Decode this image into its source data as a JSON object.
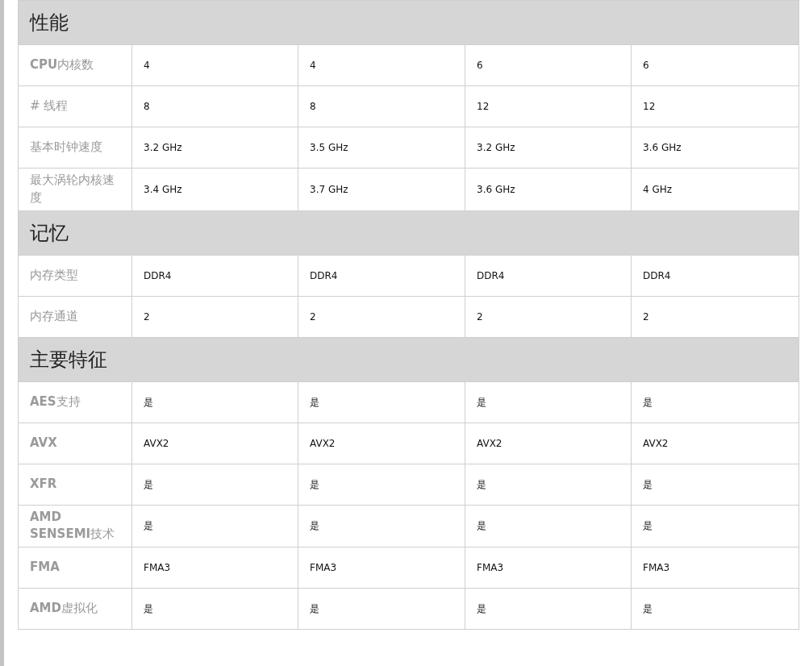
{
  "sections": [
    {
      "title": "性能",
      "rows": [
        {
          "label": "**CPU**内核数",
          "values": [
            "4",
            "4",
            "6",
            "6"
          ]
        },
        {
          "label": "# 线程",
          "values": [
            "8",
            "8",
            "12",
            "12"
          ]
        },
        {
          "label": "基本时钟速度",
          "values": [
            "3.2 GHz",
            "3.5 GHz",
            "3.2 GHz",
            "3.6 GHz"
          ]
        },
        {
          "label": "最大涡轮内核速度",
          "values": [
            "3.4 GHz",
            "3.7 GHz",
            "3.6 GHz",
            "4 GHz"
          ]
        }
      ]
    },
    {
      "title": "记忆",
      "rows": [
        {
          "label": "内存类型",
          "values": [
            "DDR4",
            "DDR4",
            "DDR4",
            "DDR4"
          ]
        },
        {
          "label": "内存通道",
          "values": [
            "2",
            "2",
            "2",
            "2"
          ]
        }
      ]
    },
    {
      "title": "主要特征",
      "rows": [
        {
          "label": "**AES**支持",
          "values": [
            "是",
            "是",
            "是",
            "是"
          ]
        },
        {
          "label": "**AVX**",
          "values": [
            "AVX2",
            "AVX2",
            "AVX2",
            "AVX2"
          ]
        },
        {
          "label": "**XFR**",
          "values": [
            "是",
            "是",
            "是",
            "是"
          ]
        },
        {
          "label": "**AMD SENSEMI**技术",
          "values": [
            "是",
            "是",
            "是",
            "是"
          ]
        },
        {
          "label": "**FMA**",
          "values": [
            "FMA3",
            "FMA3",
            "FMA3",
            "FMA3"
          ]
        },
        {
          "label": "**AMD**虚拟化",
          "values": [
            "是",
            "是",
            "是",
            "是"
          ]
        }
      ]
    }
  ]
}
